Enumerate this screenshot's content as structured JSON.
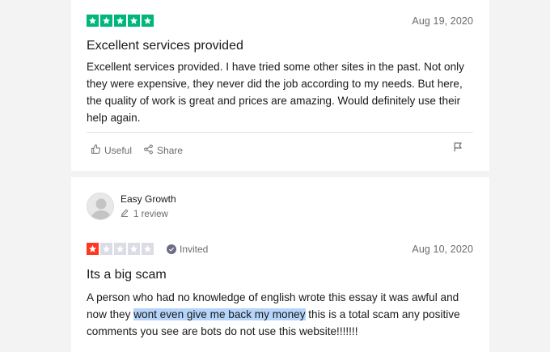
{
  "reviews": [
    {
      "rating": 5,
      "date": "Aug 19, 2020",
      "title": "Excellent services provided",
      "body": "Excellent services provided. I have tried some other sites in the past. Not only they were expensive, they never did the job according to my needs. But here, the quality of work is great and prices are amazing. Would definitely use their help again.",
      "useful_label": "Useful",
      "share_label": "Share"
    },
    {
      "reviewer_name": "Easy Growth",
      "review_count": "1 review",
      "rating": 1,
      "invited_label": "Invited",
      "date": "Aug 10, 2020",
      "title": "Its a big scam",
      "body_before": "A person who had no knowledge of english wrote this essay it was awful and now they ",
      "body_highlight": "wont even give me back my money",
      "body_after": " this is a total scam any positive comments you see are bots do not use this website!!!!!!!"
    }
  ],
  "colors": {
    "star_green": "#00b67a",
    "star_red": "#ff3722",
    "star_empty": "#dcdce6",
    "selection_highlight": "#b5d5fb"
  }
}
